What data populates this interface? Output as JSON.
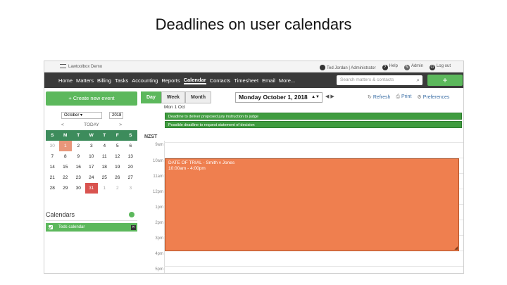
{
  "slide_title": "Deadlines on user calendars",
  "topbar": {
    "app_name": "Lawtoolbox Demo",
    "user": "Ted Jordan | Administrator",
    "help": "Help",
    "admin": "Admin",
    "logout": "Log out"
  },
  "nav": {
    "items": [
      "Home",
      "Matters",
      "Billing",
      "Tasks",
      "Accounting",
      "Reports",
      "Calendar",
      "Contacts",
      "Timesheet",
      "Email",
      "More..."
    ],
    "active": "Calendar",
    "search_placeholder": "Search matters & contacts",
    "plus_label": "+"
  },
  "sidebar": {
    "create_label": "+ Create new event",
    "month_value": "October",
    "year_value": "2018",
    "prev": "<",
    "today": "TODAY",
    "next": ">",
    "weekdays": [
      "S",
      "M",
      "T",
      "W",
      "T",
      "F",
      "S"
    ],
    "weeks": [
      [
        "30",
        "1",
        "2",
        "3",
        "4",
        "5",
        "6"
      ],
      [
        "7",
        "8",
        "9",
        "10",
        "11",
        "12",
        "13"
      ],
      [
        "14",
        "15",
        "16",
        "17",
        "18",
        "19",
        "20"
      ],
      [
        "21",
        "22",
        "23",
        "24",
        "25",
        "26",
        "27"
      ],
      [
        "28",
        "29",
        "30",
        "31",
        "1",
        "2",
        "3"
      ]
    ],
    "calendars_heading": "Calendars",
    "calendar_items": [
      "Teds calendar"
    ]
  },
  "toolbar": {
    "views": [
      "Day",
      "Week",
      "Month"
    ],
    "active_view": "Day",
    "date_value": "Monday October 1, 2018",
    "prev_arrow": "◀",
    "next_arrow": "▶",
    "refresh": "Refresh",
    "print": "Print",
    "preferences": "Preferences"
  },
  "day_view": {
    "day_header": "Mon 1 Oct",
    "deadlines": [
      "Deadline to deliver proposed jury instruction to judge",
      "Possible deadline to request statement of decision"
    ],
    "timezone": "NZST",
    "hours": [
      "9am",
      "10am",
      "11am",
      "12pm",
      "1pm",
      "2pm",
      "3pm",
      "4pm",
      "5pm"
    ],
    "event": {
      "title": "DATE OF TRIAL - Smith v Jones",
      "time": "10:00am - 4:00pm"
    }
  },
  "colors": {
    "accent_green": "#5cb85c",
    "nav_dark": "#3a3a3a",
    "event_orange": "#ef7f4f",
    "today_red": "#d9534f"
  }
}
